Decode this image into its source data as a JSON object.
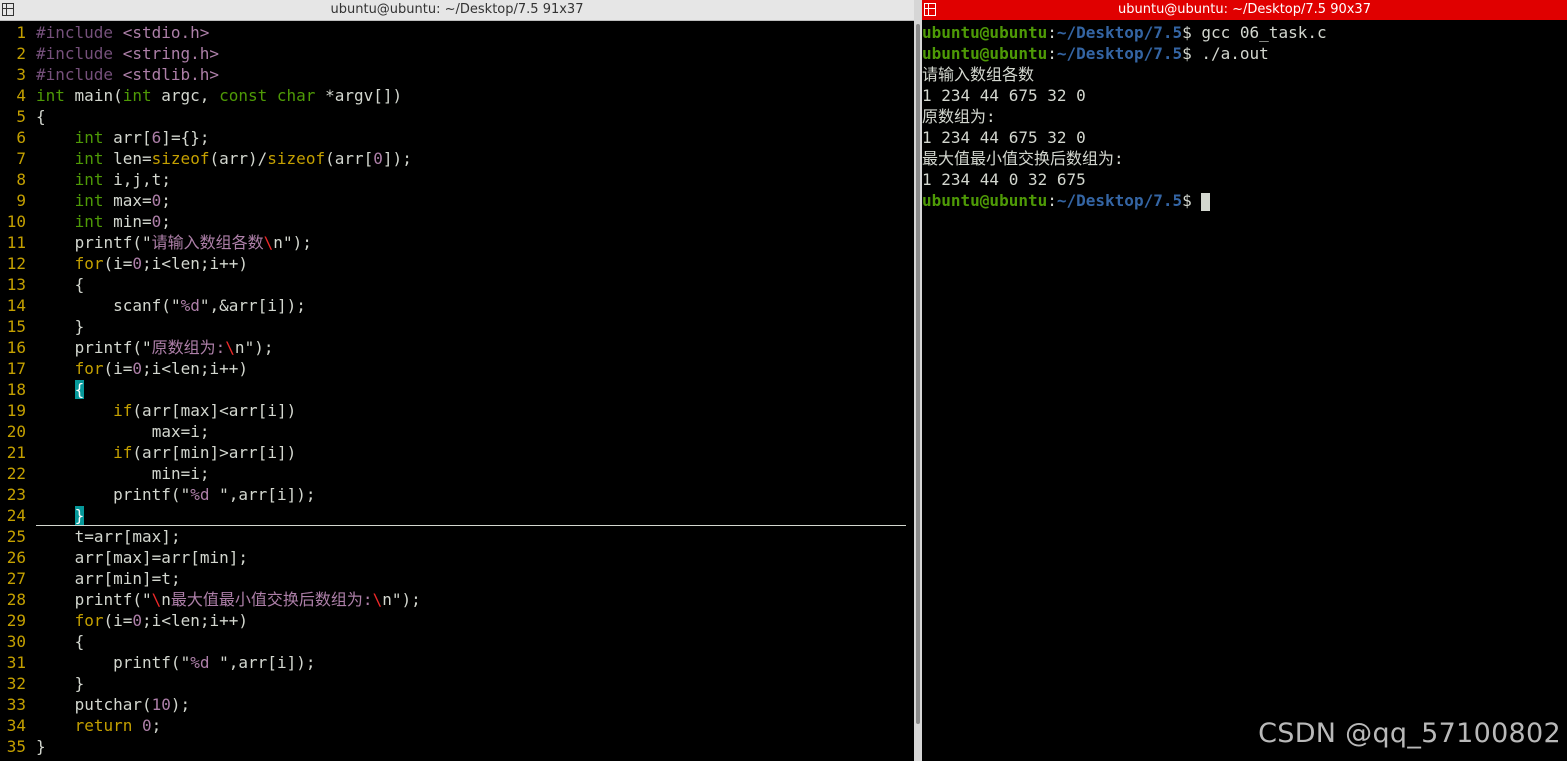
{
  "left_window": {
    "title": "ubuntu@ubuntu: ~/Desktop/7.5 91x37"
  },
  "right_window": {
    "title": "ubuntu@ubuntu: ~/Desktop/7.5 90x37"
  },
  "editor": {
    "lines": [
      {
        "n": "1",
        "t": "#include <stdio.h>"
      },
      {
        "n": "2",
        "t": "#include <string.h>"
      },
      {
        "n": "3",
        "t": "#include <stdlib.h>"
      },
      {
        "n": "4",
        "t": "int main(int argc, const char *argv[])"
      },
      {
        "n": "5",
        "t": "{"
      },
      {
        "n": "6",
        "t": "    int arr[6]={};"
      },
      {
        "n": "7",
        "t": "    int len=sizeof(arr)/sizeof(arr[0]);"
      },
      {
        "n": "8",
        "t": "    int i,j,t;"
      },
      {
        "n": "9",
        "t": "    int max=0;"
      },
      {
        "n": "10",
        "t": "    int min=0;"
      },
      {
        "n": "11",
        "t": "    printf(\"请输入数组各数\\n\");"
      },
      {
        "n": "12",
        "t": "    for(i=0;i<len;i++)"
      },
      {
        "n": "13",
        "t": "    {"
      },
      {
        "n": "14",
        "t": "        scanf(\"%d\",&arr[i]);"
      },
      {
        "n": "15",
        "t": "    }"
      },
      {
        "n": "16",
        "t": "    printf(\"原数组为:\\n\");"
      },
      {
        "n": "17",
        "t": "    for(i=0;i<len;i++)"
      },
      {
        "n": "18",
        "t": "    {"
      },
      {
        "n": "19",
        "t": "        if(arr[max]<arr[i])"
      },
      {
        "n": "20",
        "t": "            max=i;"
      },
      {
        "n": "21",
        "t": "        if(arr[min]>arr[i])"
      },
      {
        "n": "22",
        "t": "            min=i;"
      },
      {
        "n": "23",
        "t": "        printf(\"%d \",arr[i]);"
      },
      {
        "n": "24",
        "t": "    }"
      },
      {
        "n": "25",
        "t": "    t=arr[max];"
      },
      {
        "n": "26",
        "t": "    arr[max]=arr[min];"
      },
      {
        "n": "27",
        "t": "    arr[min]=t;"
      },
      {
        "n": "28",
        "t": "    printf(\"\\n最大值最小值交换后数组为:\\n\");"
      },
      {
        "n": "29",
        "t": "    for(i=0;i<len;i++)"
      },
      {
        "n": "30",
        "t": "    {"
      },
      {
        "n": "31",
        "t": "        printf(\"%d \",arr[i]);"
      },
      {
        "n": "32",
        "t": "    }"
      },
      {
        "n": "33",
        "t": "    putchar(10);"
      },
      {
        "n": "34",
        "t": "    return 0;"
      },
      {
        "n": "35",
        "t": "}"
      }
    ]
  },
  "terminal": {
    "prompt_user": "ubuntu@ubuntu",
    "prompt_sep": ":",
    "prompt_path": "~/Desktop/7.5",
    "prompt_end": "$ ",
    "cmd1": "gcc 06_task.c",
    "cmd2": "./a.out",
    "out1": "请输入数组各数",
    "out2": "1 234 44 675 32 0",
    "out3": "原数组为:",
    "out4": "1 234 44 675 32 0",
    "out5": "最大值最小值交换后数组为:",
    "out6": "1 234 44 0 32 675"
  },
  "watermark": "CSDN @qq_57100802"
}
